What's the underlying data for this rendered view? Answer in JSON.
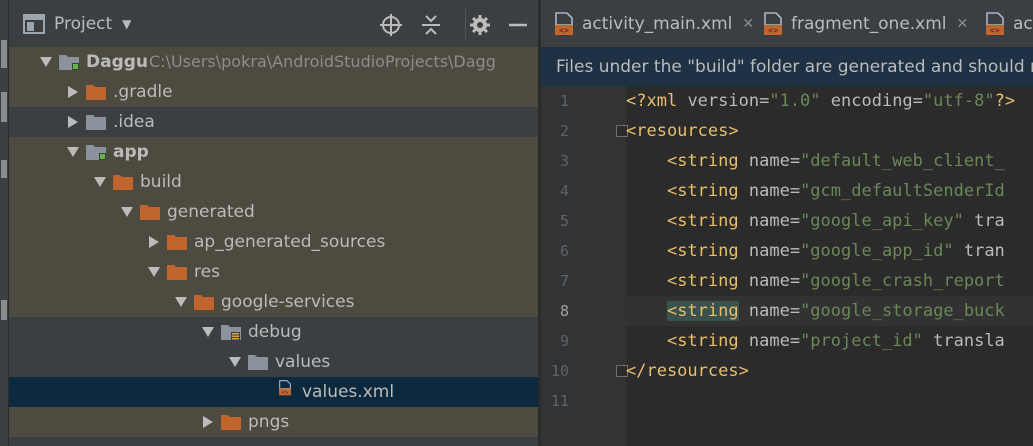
{
  "project_panel": {
    "title": "Project",
    "root_path": "C:\\Users\\pokra\\AndroidStudioProjects\\Dagg",
    "tree": [
      {
        "label": "Daggu",
        "expanded": true,
        "icon": "module-folder",
        "bold": true,
        "highlight": true
      },
      {
        "label": ".gradle",
        "expanded": false,
        "icon": "folder-orange",
        "bold": false,
        "highlight": true
      },
      {
        "label": ".idea",
        "expanded": false,
        "icon": "folder-gray",
        "bold": false,
        "highlight": false
      },
      {
        "label": "app",
        "expanded": true,
        "icon": "module-folder",
        "bold": true,
        "highlight": true
      },
      {
        "label": "build",
        "expanded": true,
        "icon": "folder-orange",
        "bold": false,
        "highlight": true
      },
      {
        "label": "generated",
        "expanded": true,
        "icon": "folder-orange",
        "bold": false,
        "highlight": true
      },
      {
        "label": "ap_generated_sources",
        "expanded": false,
        "icon": "folder-orange",
        "bold": false,
        "highlight": true
      },
      {
        "label": "res",
        "expanded": true,
        "icon": "folder-orange",
        "bold": false,
        "highlight": true
      },
      {
        "label": "google-services",
        "expanded": true,
        "icon": "folder-orange",
        "bold": false,
        "highlight": true
      },
      {
        "label": "debug",
        "expanded": true,
        "icon": "folder-res",
        "bold": false,
        "highlight": false
      },
      {
        "label": "values",
        "expanded": true,
        "icon": "folder-gray",
        "bold": false,
        "highlight": false
      },
      {
        "label": "values.xml",
        "expanded": null,
        "icon": "xml-file",
        "bold": false,
        "selected": true
      },
      {
        "label": "pngs",
        "expanded": false,
        "icon": "folder-orange",
        "bold": false,
        "highlight": true
      }
    ]
  },
  "editor": {
    "tabs": [
      {
        "label": "activity_main.xml",
        "closable": true
      },
      {
        "label": "fragment_one.xml",
        "closable": true
      },
      {
        "label": "act",
        "closable": false
      }
    ],
    "banner": "Files under the \"build\" folder are generated and should not",
    "current_line": 8,
    "lines": [
      {
        "n": "1",
        "code": "<?xml version=\"1.0\" encoding=\"utf-8\"?>"
      },
      {
        "n": "2",
        "code": "<resources>"
      },
      {
        "n": "3",
        "code": "    <string name=\"default_web_client_"
      },
      {
        "n": "4",
        "code": "    <string name=\"gcm_defaultSenderId"
      },
      {
        "n": "5",
        "code": "    <string name=\"google_api_key\" tra"
      },
      {
        "n": "6",
        "code": "    <string name=\"google_app_id\" tran"
      },
      {
        "n": "7",
        "code": "    <string name=\"google_crash_report"
      },
      {
        "n": "8",
        "code": "    <string name=\"google_storage_buck"
      },
      {
        "n": "9",
        "code": "    <string name=\"project_id\" transla"
      },
      {
        "n": "10",
        "code": "</resources>"
      },
      {
        "n": "11",
        "code": ""
      }
    ]
  },
  "colors": {
    "panel_bg": "#3c3f41",
    "editor_bg": "#2b2b2b",
    "row_highlight": "#4d4b3f",
    "row_selected": "#0d293e",
    "banner_bg": "#1f3144",
    "folder_orange": "#c1652f",
    "folder_gray": "#8a939b",
    "xml_tag": "#e8bf6a",
    "xml_value": "#6a8759"
  }
}
